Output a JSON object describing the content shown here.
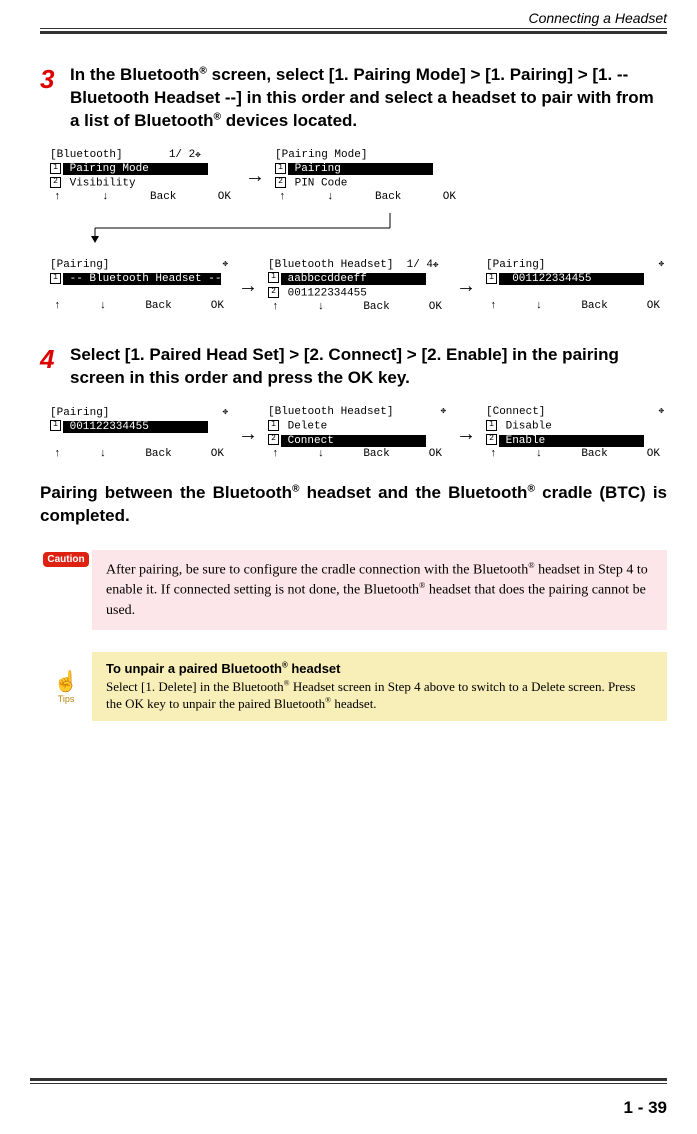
{
  "header": {
    "title": "Connecting a Headset"
  },
  "steps": {
    "s3": {
      "num": "3",
      "body": "In the Bluetooth® screen, select [1. Pairing Mode] > [1. Pairing] > [1. -- Bluetooth Headset --] in this order and select a headset to pair with from a list of Bluetooth® devices located."
    },
    "s4": {
      "num": "4",
      "body": "Select [1. Paired Head Set] > [2. Connect] > [2. Enable] in the pairing screen in this order and press the OK key."
    }
  },
  "completion": "Pairing between the Bluetooth® headset and the Bluetooth® cradle (BTC) is completed.",
  "caution": {
    "label": "Caution",
    "text": "After pairing, be sure to configure the cradle connection with the Bluetooth® headset in Step 4 to enable it. If connected setting is not done, the Bluetooth® headset that does the pairing cannot be used."
  },
  "tip": {
    "label": "Tips",
    "title": "To unpair a paired Bluetooth® headset",
    "text": "Select [1. Delete] in the Bluetooth® Headset screen in Step 4 above to switch to a Delete screen. Press the OK key to unpair the paired Bluetooth® headset."
  },
  "screens": {
    "a1": {
      "title": "[Bluetooth]       1/ 2",
      "line1_idx": "1",
      "line1": " Pairing Mode         ",
      "line2_idx": "2",
      "line2": " Visibility",
      "sk": [
        "↑",
        "↓",
        "Back",
        "OK"
      ]
    },
    "a2": {
      "title": "[Pairing Mode]",
      "line1_idx": "1",
      "line1": " Pairing              ",
      "line2_idx": "2",
      "line2": " PIN Code",
      "sk": [
        "↑",
        "↓",
        "Back",
        "OK"
      ]
    },
    "b1": {
      "title": "[Pairing]",
      "line1_idx": "1",
      "line1": " -- Bluetooth Headset --",
      "line2_idx": "",
      "line2": "",
      "sk": [
        "↑",
        "↓",
        "Back",
        "OK"
      ]
    },
    "b2": {
      "title": "[Bluetooth Headset]  1/ 4",
      "line1_idx": "1",
      "line1": " aabbccddeeff         ",
      "line2_idx": "2",
      "line2": " 001122334455",
      "sk": [
        "↑",
        "↓",
        "Back",
        "OK"
      ]
    },
    "b3": {
      "title": "[Pairing]",
      "line1_idx": "1",
      "line1": "  001122334455        ",
      "line2_idx": "",
      "line2": "",
      "sk": [
        "↑",
        "↓",
        "Back",
        "OK"
      ]
    },
    "c1": {
      "title": "[Pairing]",
      "line1_idx": "1",
      "line1": " 001122334455         ",
      "line2_idx": "",
      "line2": "",
      "sk": [
        "↑",
        "↓",
        "Back",
        "OK"
      ]
    },
    "c2": {
      "title": "[Bluetooth Headset]",
      "line1_idx": "1",
      "line1": " Delete",
      "line2_idx": "2",
      "line2": " Connect              ",
      "sk": [
        "↑",
        "↓",
        "Back",
        "OK"
      ]
    },
    "c3": {
      "title": "[Connect]",
      "line1_idx": "1",
      "line1": " Disable",
      "line2_idx": "2",
      "line2": " Enable               ",
      "sk": [
        "↑",
        "↓",
        "Back",
        "OK"
      ]
    }
  },
  "pagenum": "1 - 39"
}
